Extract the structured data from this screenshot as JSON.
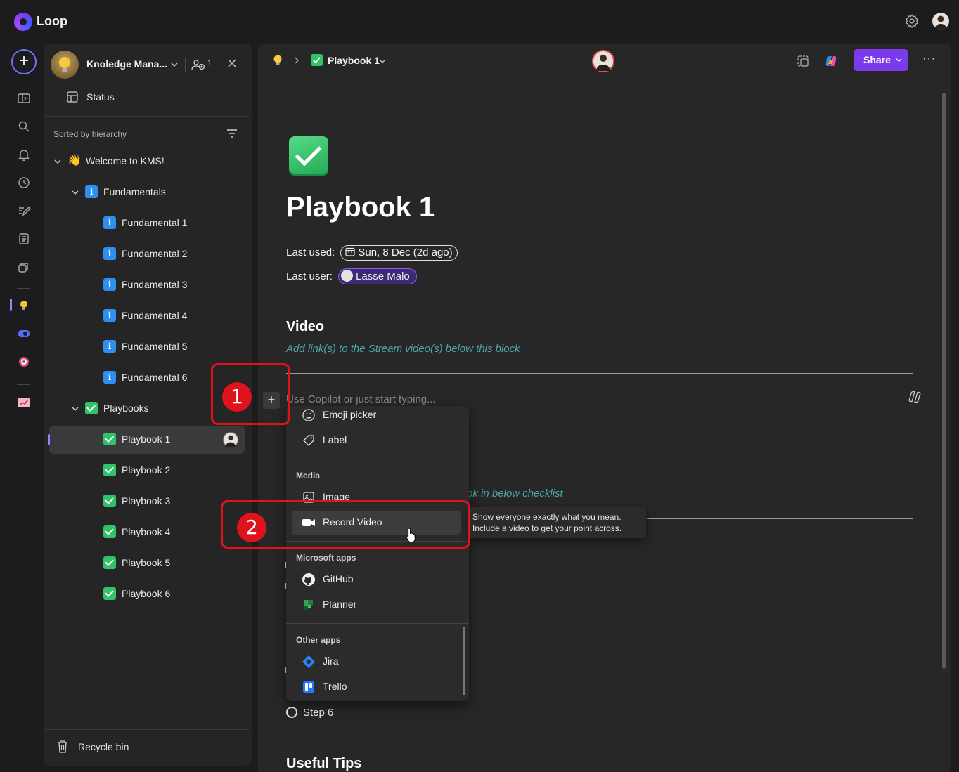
{
  "app": {
    "name": "Loop"
  },
  "colors": {
    "accent": "#7c3aed",
    "callout": "#e0121b",
    "hint": "#4fa6a6",
    "check": "#32c36a",
    "info": "#2f8ff0"
  },
  "sidebar": {
    "workspace_name": "Knoledge Mana...",
    "member_count": "1",
    "status_label": "Status",
    "sort_label": "Sorted by hierarchy",
    "tree": [
      {
        "label": "Welcome to KMS!",
        "icon": "waving-hand-icon",
        "level": 0,
        "expanded": true
      },
      {
        "label": "Fundamentals",
        "icon": "info-icon",
        "level": 1,
        "expanded": true
      },
      {
        "label": "Fundamental 1",
        "icon": "info-icon",
        "level": 2
      },
      {
        "label": "Fundamental 2",
        "icon": "info-icon",
        "level": 2
      },
      {
        "label": "Fundamental 3",
        "icon": "info-icon",
        "level": 2
      },
      {
        "label": "Fundamental 4",
        "icon": "info-icon",
        "level": 2
      },
      {
        "label": "Fundamental 5",
        "icon": "info-icon",
        "level": 2
      },
      {
        "label": "Fundamental 6",
        "icon": "info-icon",
        "level": 2
      },
      {
        "label": "Playbooks",
        "icon": "checkmark-icon",
        "level": 1,
        "expanded": true
      },
      {
        "label": "Playbook 1",
        "icon": "checkmark-icon",
        "level": 2,
        "selected": true
      },
      {
        "label": "Playbook 2",
        "icon": "checkmark-icon",
        "level": 2
      },
      {
        "label": "Playbook 3",
        "icon": "checkmark-icon",
        "level": 2
      },
      {
        "label": "Playbook 4",
        "icon": "checkmark-icon",
        "level": 2
      },
      {
        "label": "Playbook 5",
        "icon": "checkmark-icon",
        "level": 2
      },
      {
        "label": "Playbook 6",
        "icon": "checkmark-icon",
        "level": 2
      }
    ],
    "recycle_label": "Recycle bin"
  },
  "header": {
    "breadcrumb_title": "Playbook 1",
    "share_label": "Share",
    "more_label": "···"
  },
  "page": {
    "title": "Playbook 1",
    "last_used_label": "Last used:",
    "last_used_value": "Sun, 8 Dec (2d ago)",
    "last_user_label": "Last user:",
    "last_user_value": "Lasse Malo",
    "video_heading": "Video",
    "video_hint": "Add link(s) to the Stream video(s) below this block",
    "placeholder": "Use Copilot or just start typing...",
    "checklist_hint_partial": "ok in below checklist",
    "step6": "Step 6",
    "useful_tips": "Useful Tips"
  },
  "menu": {
    "items_top": [
      {
        "label": "Emoji picker",
        "icon": "emoji-icon"
      },
      {
        "label": "Label",
        "icon": "tag-icon"
      }
    ],
    "media_heading": "Media",
    "media_items": [
      {
        "label": "Image",
        "icon": "image-icon"
      },
      {
        "label": "Record Video",
        "icon": "video-camera-icon",
        "hover": true
      }
    ],
    "ms_heading": "Microsoft apps",
    "ms_items": [
      {
        "label": "GitHub",
        "icon": "github-icon"
      },
      {
        "label": "Planner",
        "icon": "planner-icon"
      }
    ],
    "other_heading": "Other apps",
    "other_items": [
      {
        "label": "Jira",
        "icon": "jira-icon"
      },
      {
        "label": "Trello",
        "icon": "trello-icon"
      }
    ]
  },
  "tooltip": {
    "line1": "Show everyone exactly what you mean.",
    "line2": "Include a video to get your point across."
  },
  "annotations": {
    "badge1": "1",
    "badge2": "2"
  }
}
